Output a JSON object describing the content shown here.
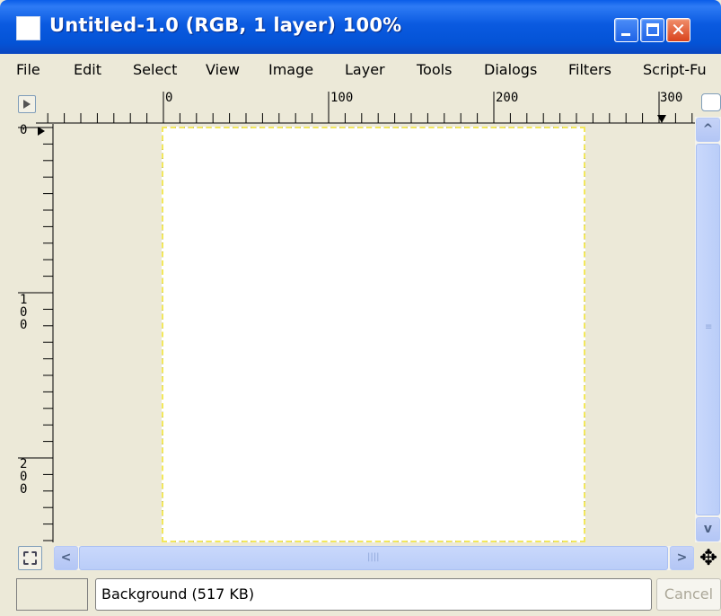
{
  "window": {
    "title": "Untitled-1.0 (RGB, 1 layer) 100%",
    "minimize_glyph": "",
    "maximize_glyph": "",
    "close_glyph": "✕"
  },
  "menu": {
    "items": [
      "File",
      "Edit",
      "Select",
      "View",
      "Image",
      "Layer",
      "Tools",
      "Dialogs",
      "Filters",
      "Script-Fu"
    ]
  },
  "rulers": {
    "horizontal_labels": [
      "0",
      "100",
      "200",
      "300"
    ],
    "vertical_labels": [
      "0",
      "1\n0\n0",
      "2\n0\n0"
    ]
  },
  "scroll": {
    "up_arrow": "^",
    "down_arrow": "v",
    "left_arrow": "<",
    "right_arrow": ">"
  },
  "status": {
    "layer_info": "Background (517 KB)",
    "cancel_label": "Cancel"
  },
  "icons": {
    "move": "✥"
  },
  "colors": {
    "titlebar": "#0a5ae0",
    "window_bg": "#ece9d8",
    "canvas": "#ffffff",
    "selection_dash": "#f3e85a"
  }
}
